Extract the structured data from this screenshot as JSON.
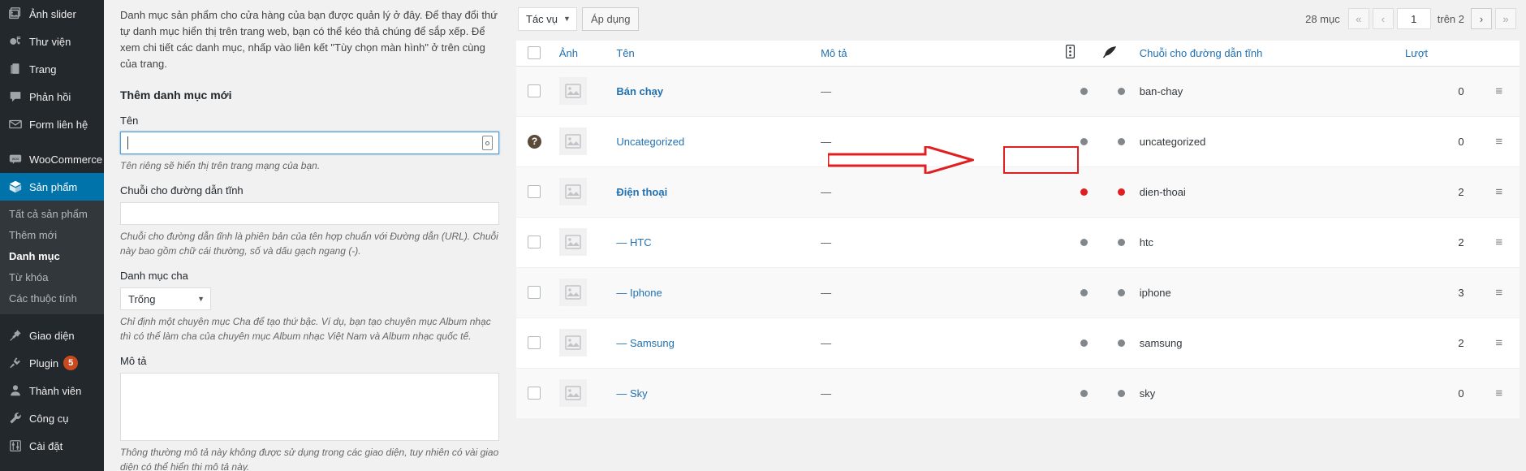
{
  "sidebar": {
    "items": [
      {
        "label": "Ảnh slider",
        "icon": "images-icon",
        "type": "item"
      },
      {
        "label": "Thư viện",
        "icon": "media-icon",
        "type": "item"
      },
      {
        "label": "Trang",
        "icon": "pages-icon",
        "type": "item"
      },
      {
        "label": "Phản hồi",
        "icon": "comments-icon",
        "type": "item"
      },
      {
        "label": "Form liên hệ",
        "icon": "envelope-icon",
        "type": "item"
      },
      {
        "label": "WooCommerce",
        "icon": "woocommerce-icon",
        "type": "item"
      },
      {
        "label": "Sản phẩm",
        "icon": "product-box-icon",
        "type": "current"
      }
    ],
    "submenu": [
      {
        "label": "Tất cả sản phẩm",
        "current": false
      },
      {
        "label": "Thêm mới",
        "current": false
      },
      {
        "label": "Danh mục",
        "current": true
      },
      {
        "label": "Từ khóa",
        "current": false
      },
      {
        "label": "Các thuộc tính",
        "current": false
      }
    ],
    "items_bottom": [
      {
        "label": "Giao diện",
        "icon": "appearance-pin-icon",
        "badge": ""
      },
      {
        "label": "Plugin",
        "icon": "plugin-plug-icon",
        "badge": "5"
      },
      {
        "label": "Thành viên",
        "icon": "user-icon",
        "badge": ""
      },
      {
        "label": "Công cụ",
        "icon": "wrench-icon",
        "badge": ""
      },
      {
        "label": "Cài đặt",
        "icon": "settings-sliders-icon",
        "badge": ""
      }
    ],
    "badge_color": "#ca4a1f",
    "current_bg": "#0073aa"
  },
  "form": {
    "intro": "Danh mục sản phẩm cho cửa hàng của bạn được quản lý ở đây. Để thay đổi thứ tự danh mục hiển thị trên trang web, bạn có thể kéo thả chúng để sắp xếp. Để xem chi tiết các danh mục, nhấp vào liên kết \"Tùy chọn màn hình\" ở trên cùng của trang.",
    "title": "Thêm danh mục mới",
    "name_label": "Tên",
    "name_value": "",
    "name_placeholder": "",
    "name_help": "Tên riêng sẽ hiển thị trên trang mạng của bạn.",
    "slug_label": "Chuỗi cho đường dẫn tĩnh",
    "slug_value": "",
    "slug_help": "Chuỗi cho đường dẫn tĩnh là phiên bản của tên hợp chuẩn với Đường dẫn (URL). Chuỗi này bao gồm chữ cái thường, số và dấu gạch ngang (-).",
    "parent_label": "Danh mục cha",
    "parent_value": "Trống",
    "parent_help": "Chỉ định một chuyên mục Cha để tạo thứ bậc. Ví dụ, bạn tạo chuyên mục Album nhạc thì có thể làm cha của chuyên mục Album nhạc Việt Nam và Album nhạc quốc tế.",
    "desc_label": "Mô tả",
    "desc_value": "",
    "desc_help": "Thông thường mô tả này không được sử dụng trong các giao diện, tuy nhiên có vài giao diện có thể hiển thị mô tả này."
  },
  "toolbar": {
    "bulk_label": "Tác vụ",
    "apply_label": "Áp dụng"
  },
  "pagination": {
    "count_label": "28 mục",
    "first": "«",
    "prev": "‹",
    "current_page": "1",
    "total_label": "trên 2",
    "next": "›",
    "last": "»"
  },
  "table": {
    "headers": {
      "checkbox": "",
      "image": "Ảnh",
      "name": "Tên",
      "description": "Mô tả",
      "icon_col1": "menu-dots-icon",
      "icon_col2": "feather-quill-icon",
      "slug": "Chuỗi cho đường dẫn tĩnh",
      "count": "Lượt",
      "handle": ""
    },
    "rows": [
      {
        "cb": "checkbox",
        "name": "Bán chạy",
        "bold": true,
        "description": "—",
        "dot1": "grey",
        "dot2": "grey",
        "slug": "ban-chay",
        "count": "0",
        "handle": "≡"
      },
      {
        "cb": "help",
        "name": "Uncategorized",
        "bold": false,
        "description": "—",
        "dot1": "grey",
        "dot2": "grey",
        "slug": "uncategorized",
        "count": "0",
        "handle": "≡"
      },
      {
        "cb": "checkbox",
        "name": "Điện thoại",
        "bold": true,
        "description": "—",
        "dot1": "red",
        "dot2": "red",
        "slug": "dien-thoai",
        "count": "2",
        "handle": "≡",
        "highlight": true
      },
      {
        "cb": "checkbox",
        "name": "— HTC",
        "bold": false,
        "description": "—",
        "dot1": "grey",
        "dot2": "grey",
        "slug": "htc",
        "count": "2",
        "handle": "≡"
      },
      {
        "cb": "checkbox",
        "name": "— Iphone",
        "bold": false,
        "description": "—",
        "dot1": "grey",
        "dot2": "grey",
        "slug": "iphone",
        "count": "3",
        "handle": "≡"
      },
      {
        "cb": "checkbox",
        "name": "— Samsung",
        "bold": false,
        "description": "—",
        "dot1": "grey",
        "dot2": "grey",
        "slug": "samsung",
        "count": "2",
        "handle": "≡"
      },
      {
        "cb": "checkbox",
        "name": "— Sky",
        "bold": false,
        "description": "—",
        "dot1": "grey",
        "dot2": "grey",
        "slug": "sky",
        "count": "0",
        "handle": "≡"
      }
    ]
  },
  "annotations": {
    "arrow_color": "#e02020",
    "box_color": "#e02020"
  }
}
